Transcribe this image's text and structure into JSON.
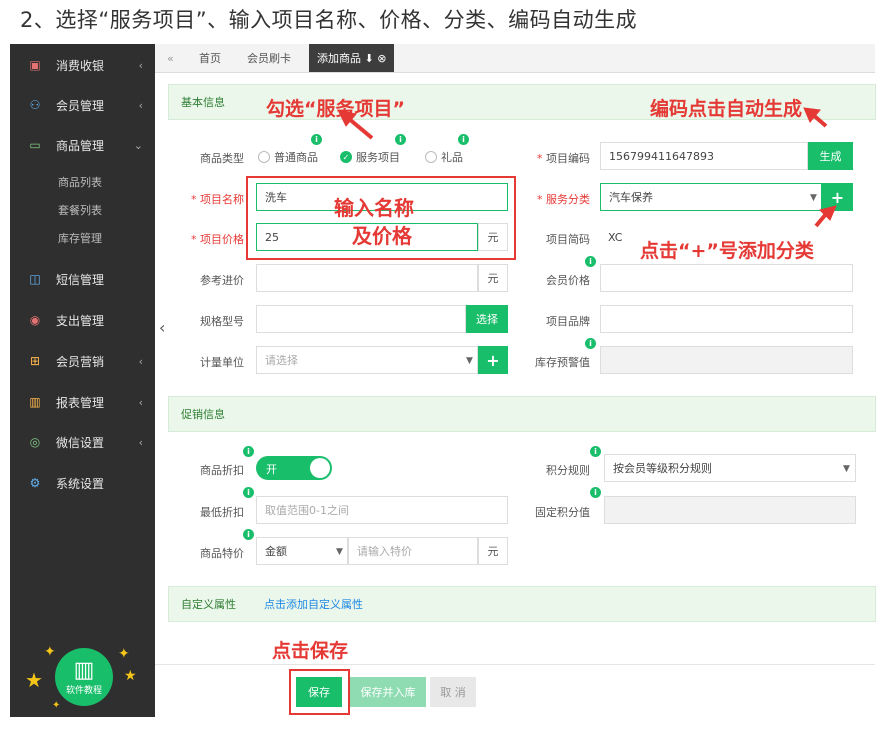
{
  "caption": "2、选择“服务项目”、输入项目名称、价格、分类、编码自动生成",
  "sidebar": {
    "items": [
      {
        "icon": "cash-register-icon",
        "label": "消费收银",
        "arrow": "‹"
      },
      {
        "icon": "members-icon",
        "label": "会员管理",
        "arrow": "‹"
      },
      {
        "icon": "goods-icon",
        "label": "商品管理",
        "arrow": "⌄"
      },
      {
        "icon": "sms-icon",
        "label": "短信管理",
        "arrow": ""
      },
      {
        "icon": "expense-icon",
        "label": "支出管理",
        "arrow": ""
      },
      {
        "icon": "gift-icon",
        "label": "会员营销",
        "arrow": "‹"
      },
      {
        "icon": "report-icon",
        "label": "报表管理",
        "arrow": "‹"
      },
      {
        "icon": "wechat-icon",
        "label": "微信设置",
        "arrow": "‹"
      },
      {
        "icon": "gear-icon",
        "label": "系统设置",
        "arrow": ""
      }
    ],
    "sub_items": [
      "商品列表",
      "套餐列表",
      "库存管理"
    ],
    "help_label": "软件教程"
  },
  "tabs": {
    "home": "首页",
    "card": "会员刷卡",
    "add": "添加商品 ⬇ ⊗"
  },
  "basic": {
    "title": "基本信息",
    "type_label": "商品类型",
    "type_options": [
      "普通商品",
      "服务项目",
      "礼品"
    ],
    "code_label": "项目编码",
    "code_value": "156799411647893",
    "generate": "生成",
    "name_label": "项目名称",
    "name_value": "洗车",
    "category_label": "服务分类",
    "category_value": "汽车保养",
    "price_label": "项目价格",
    "price_value": "25",
    "unit": "元",
    "short_label": "项目简码",
    "short_value": "XC",
    "ref_label": "参考进价",
    "member_price_label": "会员价格",
    "spec_label": "规格型号",
    "choose": "选择",
    "brand_label": "项目品牌",
    "measure_label": "计量单位",
    "measure_placeholder": "请选择",
    "stock_warn_label": "库存预警值",
    "plus": "+"
  },
  "promo": {
    "title": "促销信息",
    "discount_label": "商品折扣",
    "toggle_on": "开",
    "points_label": "积分规则",
    "points_value": "按会员等级积分规则",
    "min_discount_label": "最低折扣",
    "min_discount_placeholder": "取值范围0-1之间",
    "fixed_points_label": "固定积分值",
    "special_label": "商品特价",
    "special_type": "金额",
    "special_placeholder": "请输入特价"
  },
  "custom": {
    "title": "自定义属性",
    "add_link": "点击添加自定义属性"
  },
  "actions": {
    "save": "保存",
    "save_stock": "保存并入库",
    "cancel": "取 消"
  },
  "annotations": {
    "check_service": "勾选“服务项目”",
    "code_auto": "编码点击自动生成",
    "input_name_1": "输入名称",
    "input_name_2": "及价格",
    "add_category": "点击“+”号添加分类",
    "click_save": "点击保存"
  },
  "colors": {
    "accent": "#19be6b",
    "annotation": "#e53935",
    "sidebar": "#2f2f2f"
  }
}
